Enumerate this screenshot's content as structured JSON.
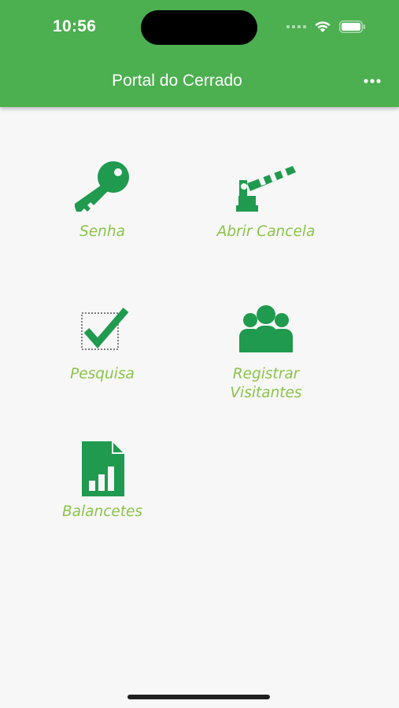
{
  "status_bar": {
    "time": "10:56"
  },
  "header": {
    "title": "Portal do Cerrado",
    "menu_icon": "more-horizontal-icon"
  },
  "colors": {
    "header": "#4caf50",
    "icon": "#1f9a4f",
    "label": "#8bc34a",
    "background": "#f7f7f7"
  },
  "menu": {
    "items": [
      {
        "label": "Senha",
        "icon": "key-icon"
      },
      {
        "label": "Abrir Cancela",
        "icon": "barrier-gate-icon"
      },
      {
        "label": "Pesquisa",
        "icon": "checkbox-check-icon"
      },
      {
        "label": "Registrar Visitantes",
        "icon": "people-group-icon"
      },
      {
        "label": "Balancetes",
        "icon": "spreadsheet-chart-icon"
      }
    ]
  }
}
